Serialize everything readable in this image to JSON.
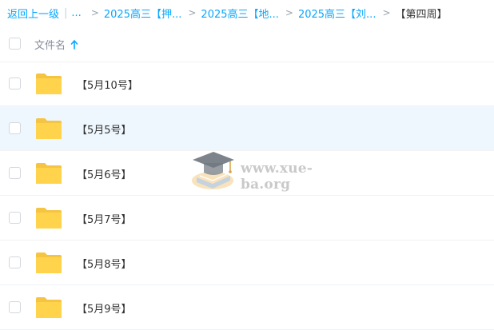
{
  "breadcrumb": {
    "back": "返回上一级",
    "separator": "|",
    "ellipsis": "...",
    "items": [
      "2025高三【押...",
      "2025高三【地...",
      "2025高三【刘..."
    ],
    "current": "【第四周】"
  },
  "header": {
    "label": "文件名",
    "sort_icon": "arrow-up-icon"
  },
  "files": [
    {
      "name": "【5月10号】",
      "icon": "folder-icon"
    },
    {
      "name": "【5月5号】",
      "icon": "folder-icon"
    },
    {
      "name": "【5月6号】",
      "icon": "folder-icon"
    },
    {
      "name": "【5月7号】",
      "icon": "folder-icon"
    },
    {
      "name": "【5月8号】",
      "icon": "folder-icon"
    },
    {
      "name": "【5月9号】",
      "icon": "folder-icon"
    }
  ],
  "watermark": {
    "text": "www.xue-ba.org",
    "icon": "graduation-cap-book-logo"
  },
  "colors": {
    "link": "#06a7ff",
    "folder": "#ffd34c",
    "hover_row": "#eef7fe"
  }
}
